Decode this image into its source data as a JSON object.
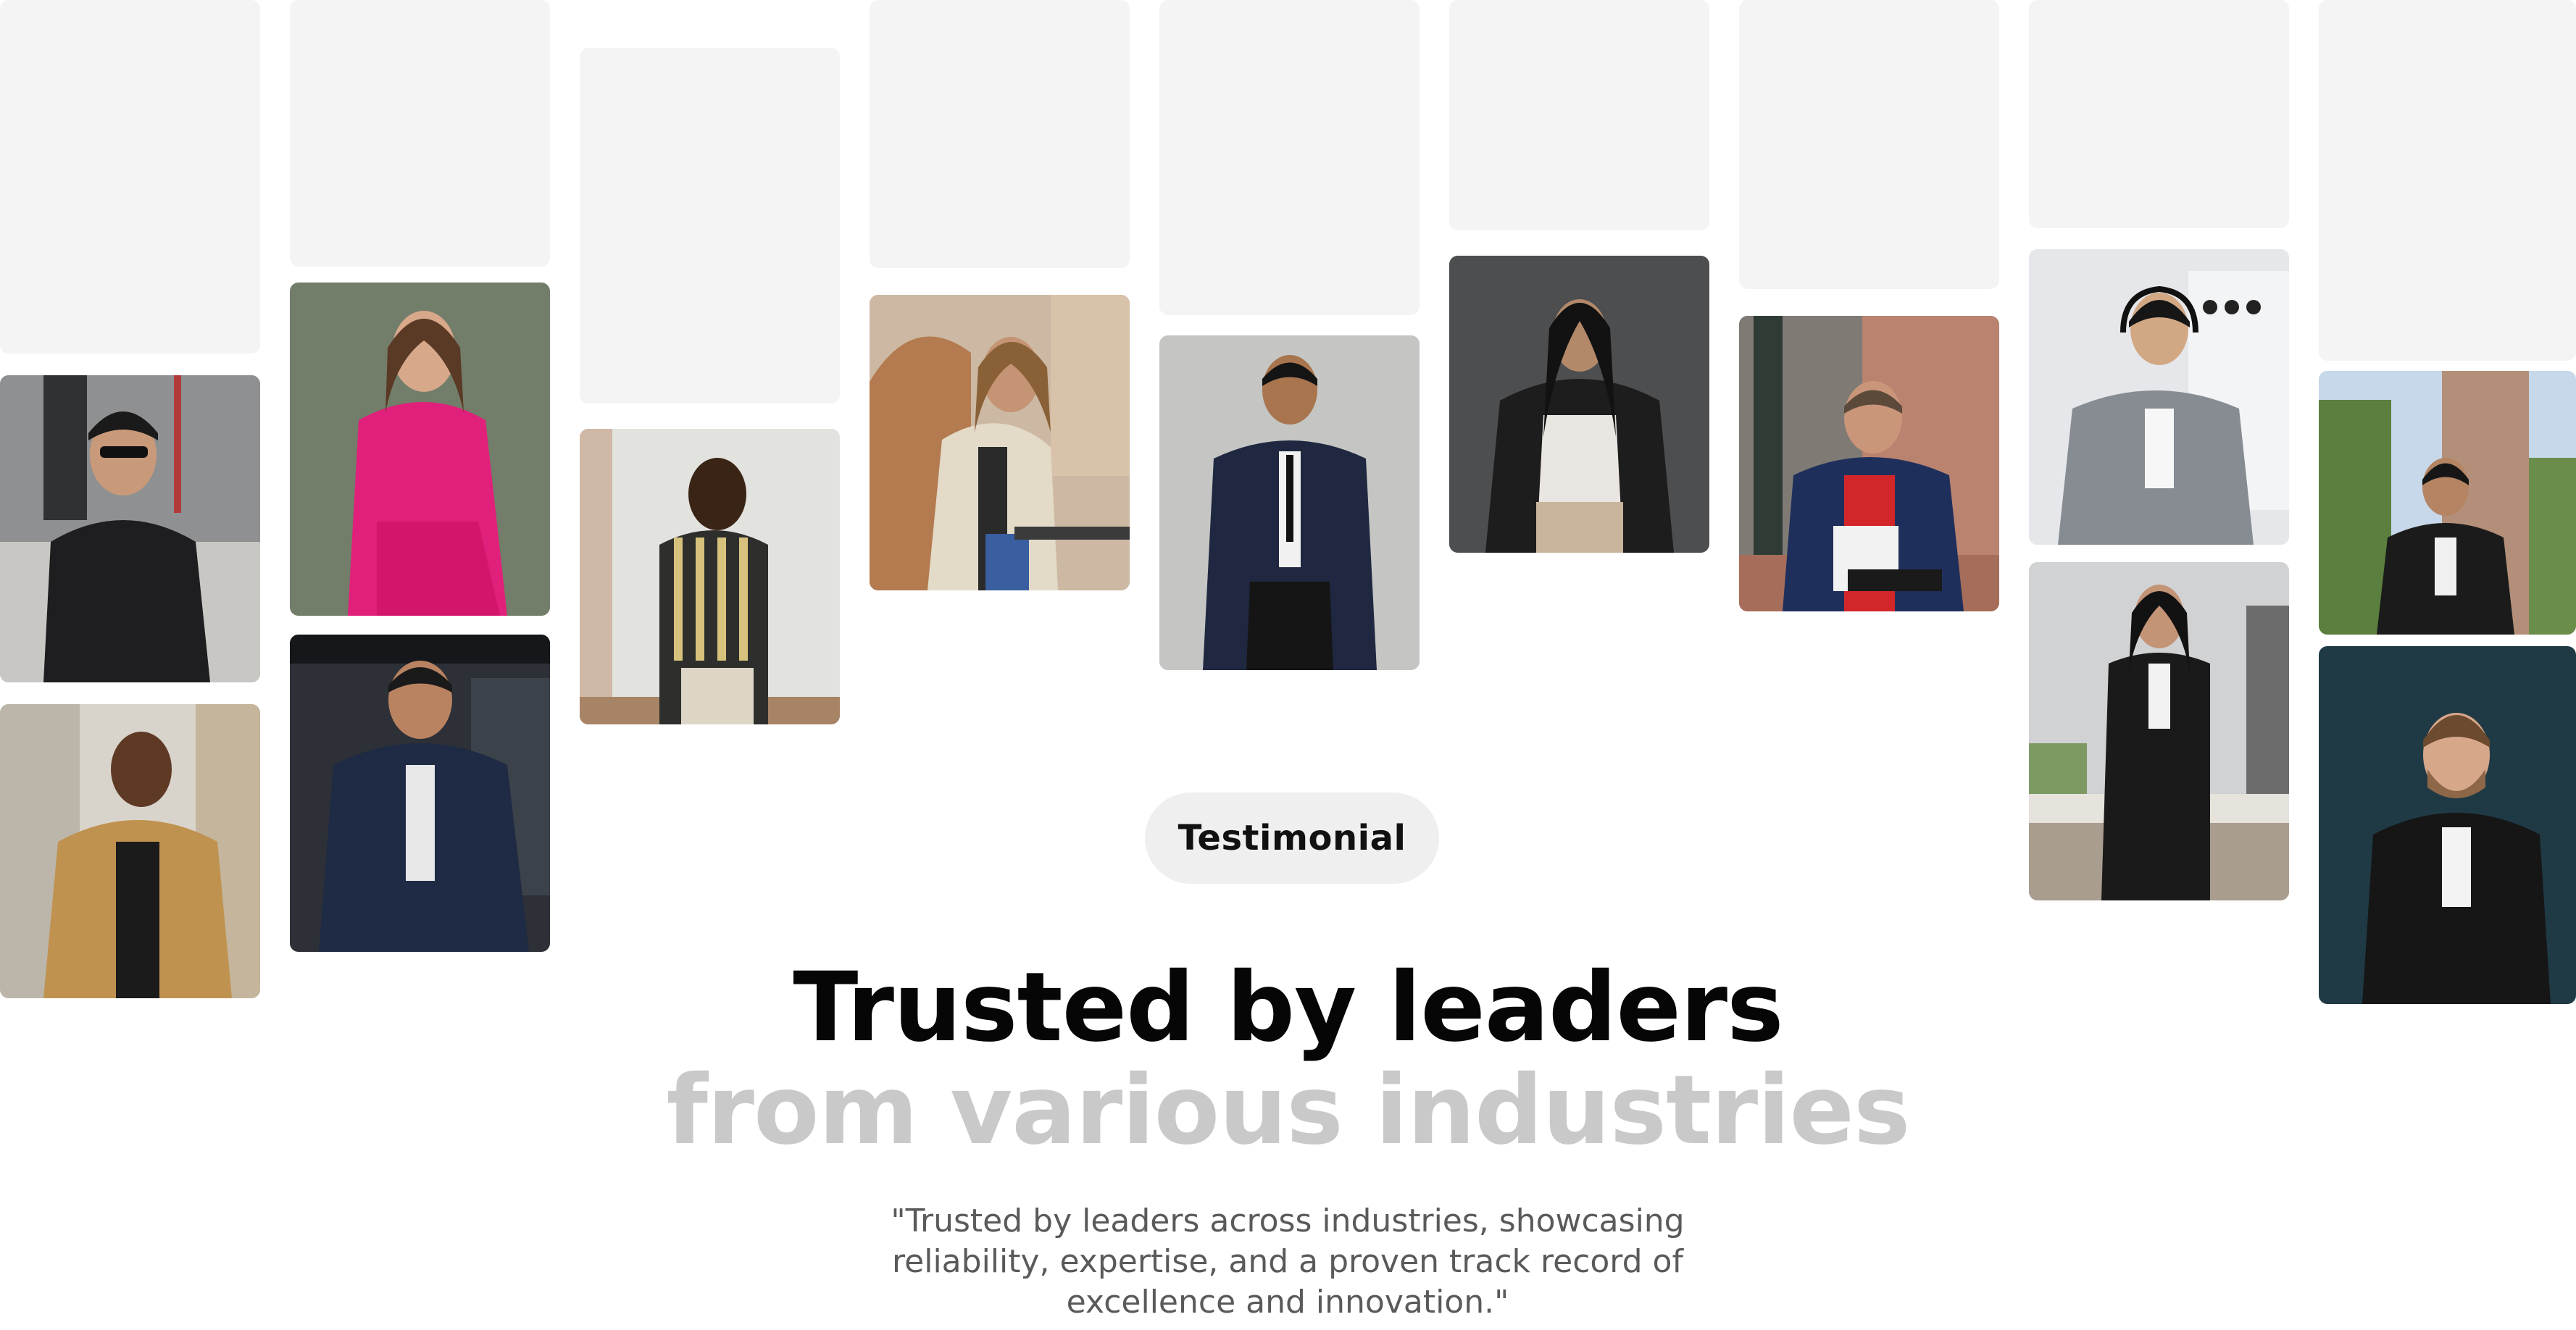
{
  "testimonial_section": {
    "badge_label": "Testimonial",
    "heading_line_1": "Trusted by leaders",
    "heading_line_2": "from various industries",
    "quote": "\"Trusted by leaders across industries, showcasing reliability, expertise, and a proven track record of excellence and innovation.\""
  },
  "colors": {
    "placeholder": "#f4f4f4",
    "heading_primary": "#060606",
    "heading_secondary": "#c9c9c9",
    "badge_background": "#efefef",
    "quote_text": "#5a5a5a"
  }
}
